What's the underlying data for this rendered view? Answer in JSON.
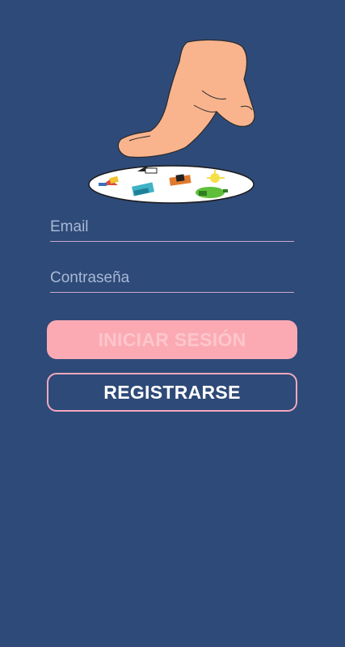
{
  "login_form": {
    "email_placeholder": "Email",
    "email_value": "",
    "password_placeholder": "Contraseña",
    "password_value": "",
    "login_button_label": "INICIAR SESIÓN",
    "register_button_label": "REGISTRARSE"
  },
  "colors": {
    "background": "#2e4a78",
    "login_button": "#fbaab3",
    "register_border": "#f4a9be",
    "field_underline": "#c9a9c8"
  },
  "icons": {
    "logo": "finger-pointing-at-plate-icon"
  }
}
